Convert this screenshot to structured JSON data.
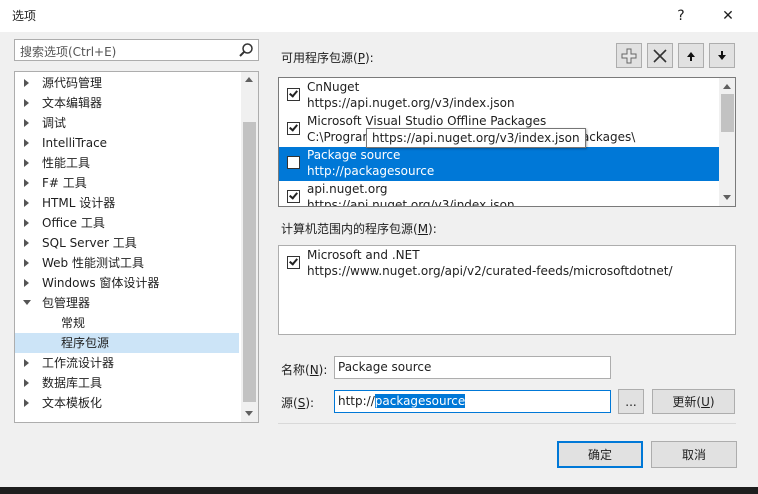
{
  "window": {
    "title": "选项",
    "help_glyph": "?",
    "close_glyph": "✕"
  },
  "search": {
    "placeholder": "搜索选项(Ctrl+E)"
  },
  "tree": {
    "items": [
      {
        "label": "源代码管理",
        "expand": "collapsed",
        "indent": 0,
        "selected": false
      },
      {
        "label": "文本编辑器",
        "expand": "collapsed",
        "indent": 0,
        "selected": false
      },
      {
        "label": "调试",
        "expand": "collapsed",
        "indent": 0,
        "selected": false
      },
      {
        "label": "IntelliTrace",
        "expand": "collapsed",
        "indent": 0,
        "selected": false
      },
      {
        "label": "性能工具",
        "expand": "collapsed",
        "indent": 0,
        "selected": false
      },
      {
        "label": "F# 工具",
        "expand": "collapsed",
        "indent": 0,
        "selected": false
      },
      {
        "label": "HTML 设计器",
        "expand": "collapsed",
        "indent": 0,
        "selected": false
      },
      {
        "label": "Office 工具",
        "expand": "collapsed",
        "indent": 0,
        "selected": false
      },
      {
        "label": "SQL Server 工具",
        "expand": "collapsed",
        "indent": 0,
        "selected": false
      },
      {
        "label": "Web 性能测试工具",
        "expand": "collapsed",
        "indent": 0,
        "selected": false
      },
      {
        "label": "Windows 窗体设计器",
        "expand": "collapsed",
        "indent": 0,
        "selected": false
      },
      {
        "label": "包管理器",
        "expand": "expanded",
        "indent": 0,
        "selected": false
      },
      {
        "label": "常规",
        "expand": "none",
        "indent": 1,
        "selected": false
      },
      {
        "label": "程序包源",
        "expand": "none",
        "indent": 1,
        "selected": true
      },
      {
        "label": "工作流设计器",
        "expand": "collapsed",
        "indent": 0,
        "selected": false
      },
      {
        "label": "数据库工具",
        "expand": "collapsed",
        "indent": 0,
        "selected": false
      },
      {
        "label": "文本模板化",
        "expand": "collapsed",
        "indent": 0,
        "selected": false
      }
    ]
  },
  "available": {
    "label_prefix": "可用程序包源(",
    "label_key": "P",
    "label_suffix": "):",
    "sources": [
      {
        "name": "CnNuget",
        "url": "https://api.nuget.org/v3/index.json",
        "checked": true,
        "selected": false
      },
      {
        "name": "Microsoft Visual Studio Offline Packages",
        "url": "C:\\Program Files (x86)\\Microsoft SDKs\\NuGetPackages\\",
        "checked": true,
        "selected": false
      },
      {
        "name": "Package source",
        "url": "http://packagesource",
        "checked": false,
        "selected": true
      },
      {
        "name": "api.nuget.org",
        "url": "https://api.nuget.org/v3/index.json",
        "checked": true,
        "selected": false
      }
    ],
    "tooltip": "https://api.nuget.org/v3/index.json"
  },
  "machine": {
    "label_prefix": "计算机范围内的程序包源(",
    "label_key": "M",
    "label_suffix": "):",
    "sources": [
      {
        "name": "Microsoft and .NET",
        "url": "https://www.nuget.org/api/v2/curated-feeds/microsoftdotnet/",
        "checked": true
      }
    ]
  },
  "form": {
    "name_label_prefix": "名称(",
    "name_label_key": "N",
    "name_label_suffix": "):",
    "name_value": "Package source",
    "source_label_prefix": "源(",
    "source_label_key": "S",
    "source_label_suffix": "):",
    "source_value_plain": "http://",
    "source_value_selected": "packagesource",
    "browse_label": "...",
    "update_label_prefix": "更新(",
    "update_label_key": "U",
    "update_label_suffix": ")"
  },
  "footer": {
    "ok_label": "确定",
    "cancel_label": "取消"
  }
}
